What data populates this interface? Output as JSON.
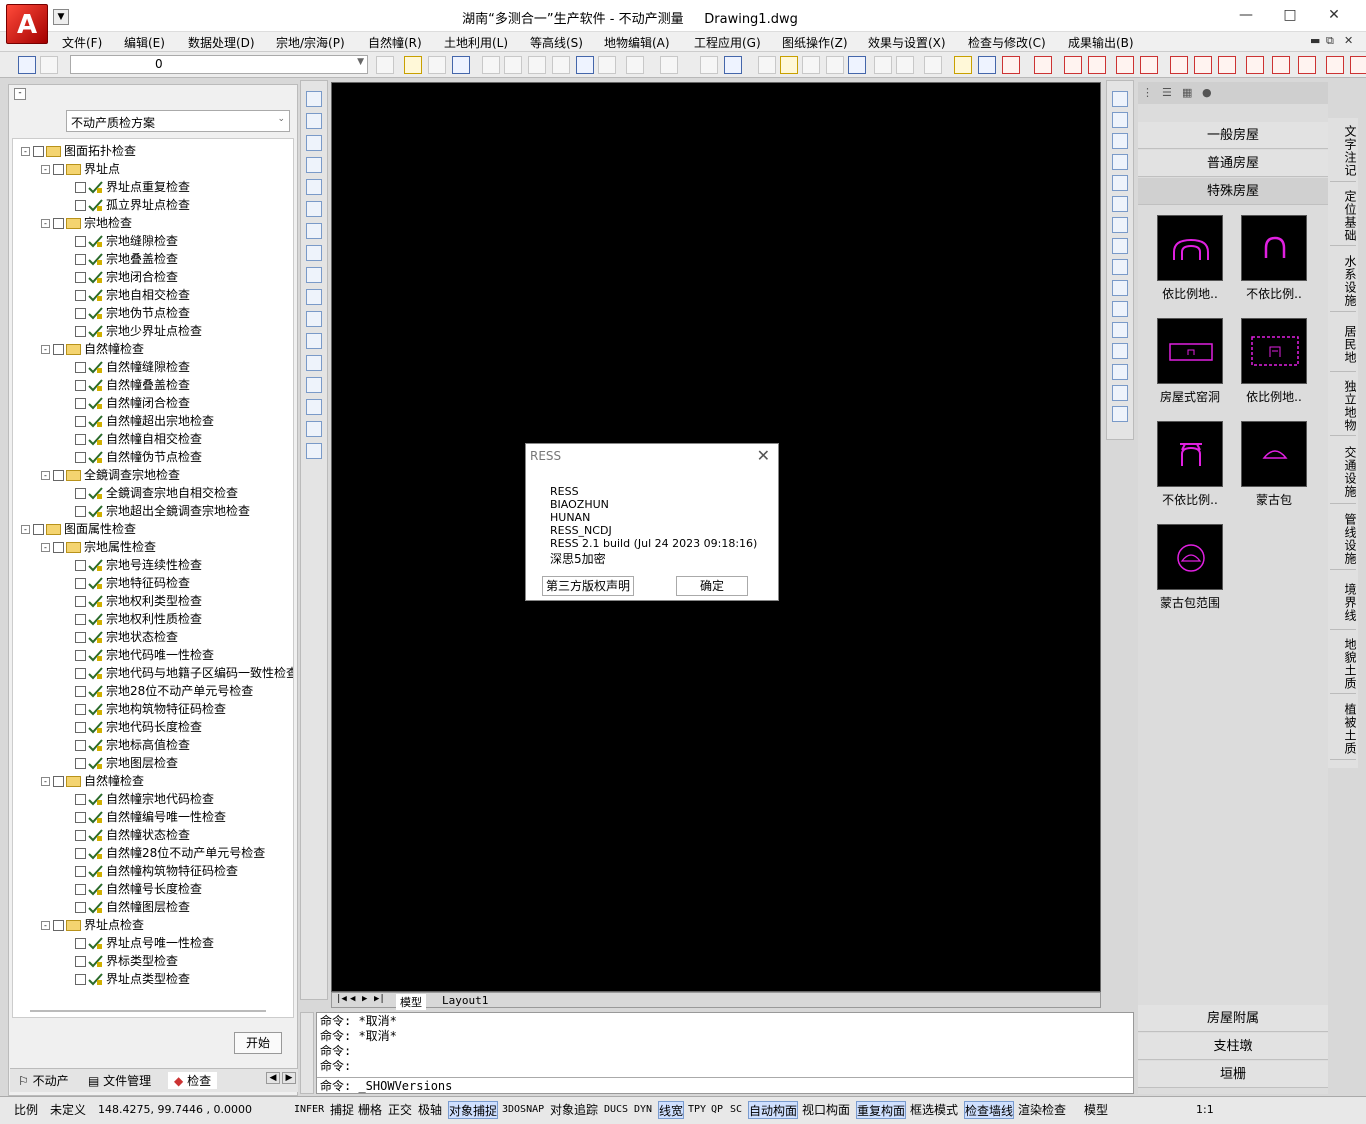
{
  "app": {
    "title": "湖南“多测合一”生产软件 - 不动产测量",
    "document": "Drawing1.dwg",
    "logo": "A"
  },
  "menu": [
    "文件(F)",
    "编辑(E)",
    "数据处理(D)",
    "宗地/宗海(P)",
    "自然幢(R)",
    "土地利用(L)",
    "等高线(S)",
    "地物编辑(A)",
    "工程应用(G)",
    "图纸操作(Z)",
    "效果与设置(X)",
    "检查与修改(C)",
    "成果输出(B)"
  ],
  "toolbar": {
    "layer_value": "0"
  },
  "left_panel": {
    "scheme": "不动产质检方案",
    "tree": [
      {
        "lvl": 0,
        "type": "folder",
        "label": "图面拓扑检查"
      },
      {
        "lvl": 1,
        "type": "folder",
        "label": "界址点"
      },
      {
        "lvl": 2,
        "type": "check",
        "label": "界址点重复检查"
      },
      {
        "lvl": 2,
        "type": "check",
        "label": "孤立界址点检查"
      },
      {
        "lvl": 1,
        "type": "folder",
        "label": "宗地检查"
      },
      {
        "lvl": 2,
        "type": "check",
        "label": "宗地缝隙检查"
      },
      {
        "lvl": 2,
        "type": "check",
        "label": "宗地叠盖检查"
      },
      {
        "lvl": 2,
        "type": "check",
        "label": "宗地闭合检查"
      },
      {
        "lvl": 2,
        "type": "check",
        "label": "宗地自相交检查"
      },
      {
        "lvl": 2,
        "type": "check",
        "label": "宗地伪节点检查"
      },
      {
        "lvl": 2,
        "type": "check",
        "label": "宗地少界址点检查"
      },
      {
        "lvl": 1,
        "type": "folder",
        "label": "自然幢检查"
      },
      {
        "lvl": 2,
        "type": "check",
        "label": "自然幢缝隙检查"
      },
      {
        "lvl": 2,
        "type": "check",
        "label": "自然幢叠盖检查"
      },
      {
        "lvl": 2,
        "type": "check",
        "label": "自然幢闭合检查"
      },
      {
        "lvl": 2,
        "type": "check",
        "label": "自然幢超出宗地检查"
      },
      {
        "lvl": 2,
        "type": "check",
        "label": "自然幢自相交检查"
      },
      {
        "lvl": 2,
        "type": "check",
        "label": "自然幢伪节点检查"
      },
      {
        "lvl": 1,
        "type": "folder",
        "label": "全鏡调查宗地检查"
      },
      {
        "lvl": 2,
        "type": "check",
        "label": "全鏡调查宗地自相交检查"
      },
      {
        "lvl": 2,
        "type": "check",
        "label": "宗地超出全鏡调查宗地检查"
      },
      {
        "lvl": 0,
        "type": "folder",
        "label": "图面属性检查"
      },
      {
        "lvl": 1,
        "type": "folder",
        "label": "宗地属性检查"
      },
      {
        "lvl": 2,
        "type": "check",
        "label": "宗地号连续性检查"
      },
      {
        "lvl": 2,
        "type": "check",
        "label": "宗地特征码检查"
      },
      {
        "lvl": 2,
        "type": "check",
        "label": "宗地权利类型检查"
      },
      {
        "lvl": 2,
        "type": "check",
        "label": "宗地权利性质检查"
      },
      {
        "lvl": 2,
        "type": "check",
        "label": "宗地状态检查"
      },
      {
        "lvl": 2,
        "type": "check",
        "label": "宗地代码唯一性检查"
      },
      {
        "lvl": 2,
        "type": "check",
        "label": "宗地代码与地籍子区编码一致性检查"
      },
      {
        "lvl": 2,
        "type": "check",
        "label": "宗地28位不动产单元号检查"
      },
      {
        "lvl": 2,
        "type": "check",
        "label": "宗地构筑物特征码检查"
      },
      {
        "lvl": 2,
        "type": "check",
        "label": "宗地代码长度检查"
      },
      {
        "lvl": 2,
        "type": "check",
        "label": "宗地标高值检查"
      },
      {
        "lvl": 2,
        "type": "check",
        "label": "宗地图层检查"
      },
      {
        "lvl": 1,
        "type": "folder",
        "label": "自然幢检查"
      },
      {
        "lvl": 2,
        "type": "check",
        "label": "自然幢宗地代码检查"
      },
      {
        "lvl": 2,
        "type": "check",
        "label": "自然幢编号唯一性检查"
      },
      {
        "lvl": 2,
        "type": "check",
        "label": "自然幢状态检查"
      },
      {
        "lvl": 2,
        "type": "check",
        "label": "自然幢28位不动产单元号检查"
      },
      {
        "lvl": 2,
        "type": "check",
        "label": "自然幢构筑物特征码检查"
      },
      {
        "lvl": 2,
        "type": "check",
        "label": "自然幢号长度检查"
      },
      {
        "lvl": 2,
        "type": "check",
        "label": "自然幢图层检查"
      },
      {
        "lvl": 1,
        "type": "folder",
        "label": "界址点检查"
      },
      {
        "lvl": 2,
        "type": "check",
        "label": "界址点号唯一性检查"
      },
      {
        "lvl": 2,
        "type": "check",
        "label": "界标类型检查"
      },
      {
        "lvl": 2,
        "type": "check",
        "label": "界址点类型检查"
      }
    ],
    "start_button": "开始",
    "tabs": [
      "不动产",
      "文件管理",
      "检查"
    ]
  },
  "layout_tabs": [
    "模型",
    "Layout1"
  ],
  "command": {
    "lines": [
      "命令: *取消*",
      "命令: *取消*",
      "命令:",
      "命令:"
    ],
    "input": "命令: _SHOWVersions"
  },
  "dialog": {
    "title": "RESS",
    "lines": [
      "RESS",
      "BIAOZHUN",
      "HUNAN",
      "RESS_NCDJ",
      "RESS 2.1 build (Jul 24 2023 09:18:16)",
      "深思5加密"
    ],
    "btn_license": "第三方版权声明",
    "btn_ok": "确定"
  },
  "palette": {
    "headers": [
      "一般房屋",
      "普通房屋",
      "特殊房屋"
    ],
    "symbols": [
      "依比例地..",
      "不依比例..",
      "房屋式窑洞",
      "依比例地..",
      "不依比例..",
      "蒙古包",
      "蒙古包范围"
    ],
    "bottom_headers": [
      "房屋附属",
      "支柱墩",
      "垣栅"
    ],
    "vtabs": [
      "文字注记",
      "定位基础",
      "水系设施",
      "居民地",
      "独立地物",
      "交通设施",
      "管线设施",
      "境界线",
      "地貌土质",
      "植被土质"
    ]
  },
  "status": {
    "coord_label": "比例",
    "coord_state": "未定义",
    "coords": "148.4275, 99.7446 , 0.0000",
    "toggles": [
      "INFER",
      "捕捉",
      "栅格",
      "正交",
      "极轴",
      "对象捕捉",
      "3DOSNAP",
      "对象追踪",
      "DUCS",
      "DYN",
      "线宽",
      "TPY",
      "QP",
      "SC",
      "自动构面",
      "视口构面",
      "重复构面",
      "框选模式",
      "检查墙线",
      "渲染检查",
      "模型"
    ],
    "scale": "1:1"
  },
  "colors": {
    "symbol_stroke": "#e020e0",
    "highlight": "#cfe0ff"
  }
}
